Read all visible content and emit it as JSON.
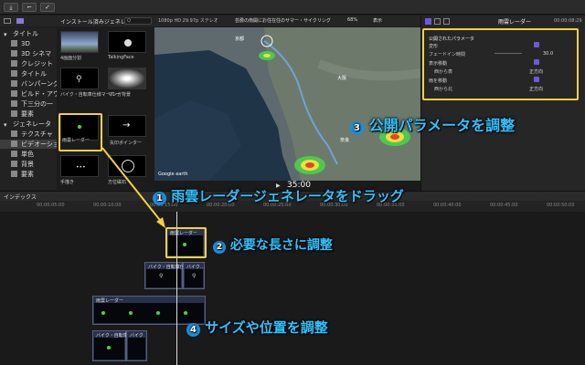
{
  "window": {
    "left_controls": [
      "⤓",
      "⌐",
      "✓"
    ]
  },
  "library": {
    "title": "インストール済みジェネレ…",
    "search_placeholder": "Q"
  },
  "sidebar": {
    "items": [
      {
        "label": "タイトル",
        "section": true
      },
      {
        "label": "3D"
      },
      {
        "label": "3D シネマ"
      },
      {
        "label": "クレジット"
      },
      {
        "label": "タイトル"
      },
      {
        "label": "バンパーング"
      },
      {
        "label": "ビルド・アウト"
      },
      {
        "label": "下三分の一"
      },
      {
        "label": "要素"
      },
      {
        "label": "ジェネレータ",
        "section": true
      },
      {
        "label": "テクスチャ"
      },
      {
        "label": "ビデオーション"
      },
      {
        "label": "単色"
      },
      {
        "label": "背景"
      },
      {
        "label": "要素"
      }
    ],
    "selected_index": 11
  },
  "browser": {
    "items": [
      {
        "label": "4画面分割"
      },
      {
        "label": "TalkingFace"
      },
      {
        "label": "バイク・自転車仕様マーカー"
      },
      {
        "label": "マンガ背景"
      },
      {
        "label": "雨雲レーダー"
      },
      {
        "label": "矢印ポインター"
      },
      {
        "label": "手描き"
      },
      {
        "label": "方位磁石"
      }
    ]
  },
  "viewer": {
    "format": "1080p HD 29.97p ステレオ",
    "title": "芸爵の南開にお住在住のサマー・サイクリング",
    "zoom": "68%",
    "display": "表示",
    "timecode": "35:00",
    "map_credit": "Google earth",
    "map_places": [
      "京都",
      "大阪",
      "奈良"
    ]
  },
  "inspector": {
    "title": "雨雲レーダー",
    "duration": "00:00:08:29",
    "section": "公開されたパラメータ",
    "params": [
      {
        "label": "変形",
        "checked": true
      },
      {
        "label": "フェードイン時間",
        "value": "30.0"
      },
      {
        "label": "表示移動",
        "checked": true
      },
      {
        "label": "西から表",
        "value": "正方向"
      },
      {
        "label": "雨を移動",
        "checked": true
      },
      {
        "label": "西から北",
        "value": "正方向"
      }
    ]
  },
  "timeline": {
    "index_label": "インデックス",
    "ruler": [
      "00:00:05:00",
      "00:00:10:00",
      "00:00:15:00",
      "00:00:20:00",
      "00:00:25:00",
      "00:00:30:00",
      "00:00:35:00",
      "00:00:40:00",
      "00:00:45:00",
      "00:00:50:00"
    ],
    "clips": [
      {
        "label": "雨雲レーダー"
      },
      {
        "label": "バイク・自転車仕様…"
      },
      {
        "label": "バイク…"
      },
      {
        "label": "雨雲レーダー"
      },
      {
        "label": "バイク・自転車…"
      },
      {
        "label": "バイク"
      }
    ]
  },
  "annotations": [
    {
      "number": "1",
      "text": "雨雲レーダージェネレータをドラッグ"
    },
    {
      "number": "2",
      "text": "必要な長さに調整"
    },
    {
      "number": "3",
      "text": "公開パラメータを調整"
    },
    {
      "number": "4",
      "text": "サイズや位置を調整"
    }
  ],
  "colors": {
    "annotation": "#2ec4ff",
    "highlight": "#f2d23a",
    "accent": "#6a5ae0",
    "number_badge": "#1a8fe0",
    "radar_green": "#47d34e",
    "radar_red": "#e8402c"
  }
}
